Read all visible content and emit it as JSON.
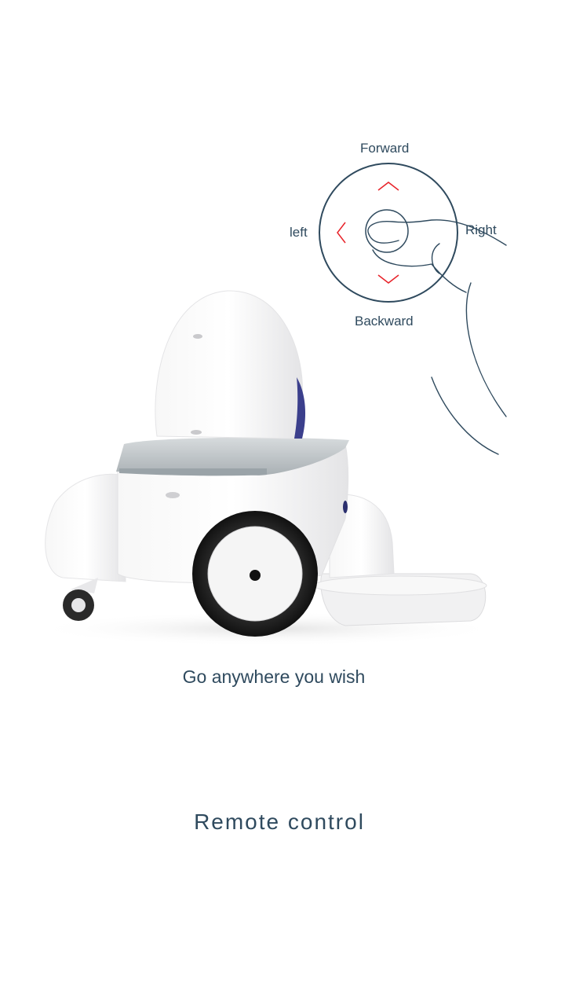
{
  "joystick": {
    "forward_label": "Forward",
    "backward_label": "Backward",
    "left_label": "left",
    "right_label": "Right",
    "arrow_color": "#e8232a",
    "ring_color": "#2f4a5e"
  },
  "caption": {
    "tagline": "Go anywhere you wish",
    "feature_title": "Remote control"
  }
}
